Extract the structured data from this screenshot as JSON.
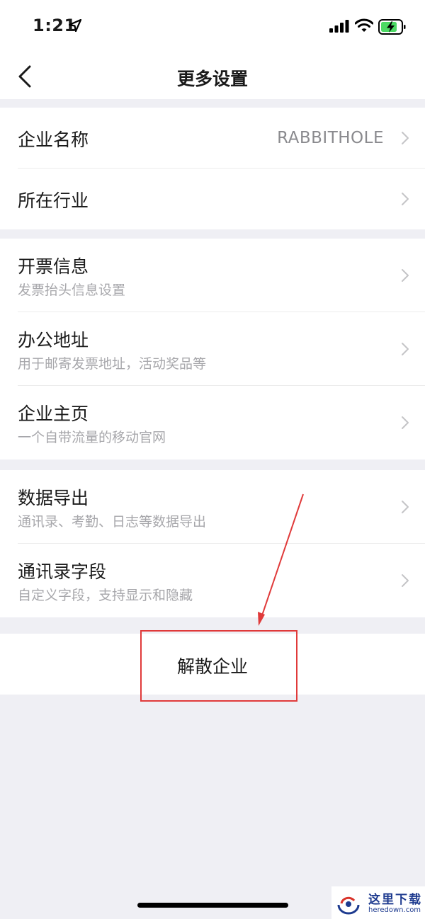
{
  "status_bar": {
    "time": "1:21"
  },
  "nav": {
    "title": "更多设置",
    "back_icon": "back-chevron-icon"
  },
  "groups": [
    {
      "items": [
        {
          "title": "企业名称",
          "value": "RABBITHOLE"
        },
        {
          "title": "所在行业"
        }
      ]
    },
    {
      "items": [
        {
          "title": "开票信息",
          "subtitle": "发票抬头信息设置"
        },
        {
          "title": "办公地址",
          "subtitle": "用于邮寄发票地址，活动奖品等"
        },
        {
          "title": "企业主页",
          "subtitle": "一个自带流量的移动官网"
        }
      ]
    },
    {
      "items": [
        {
          "title": "数据导出",
          "subtitle": "通讯录、考勤、日志等数据导出"
        },
        {
          "title": "通讯录字段",
          "subtitle": "自定义字段，支持显示和隐藏"
        }
      ]
    }
  ],
  "danger": {
    "dissolve_label": "解散企业"
  },
  "watermark": {
    "brand": "这里下载",
    "url": "heredown.com"
  },
  "colors": {
    "accent_annotation": "#e03a3a",
    "background": "#efeff4",
    "battery_fill": "#4cd964"
  }
}
